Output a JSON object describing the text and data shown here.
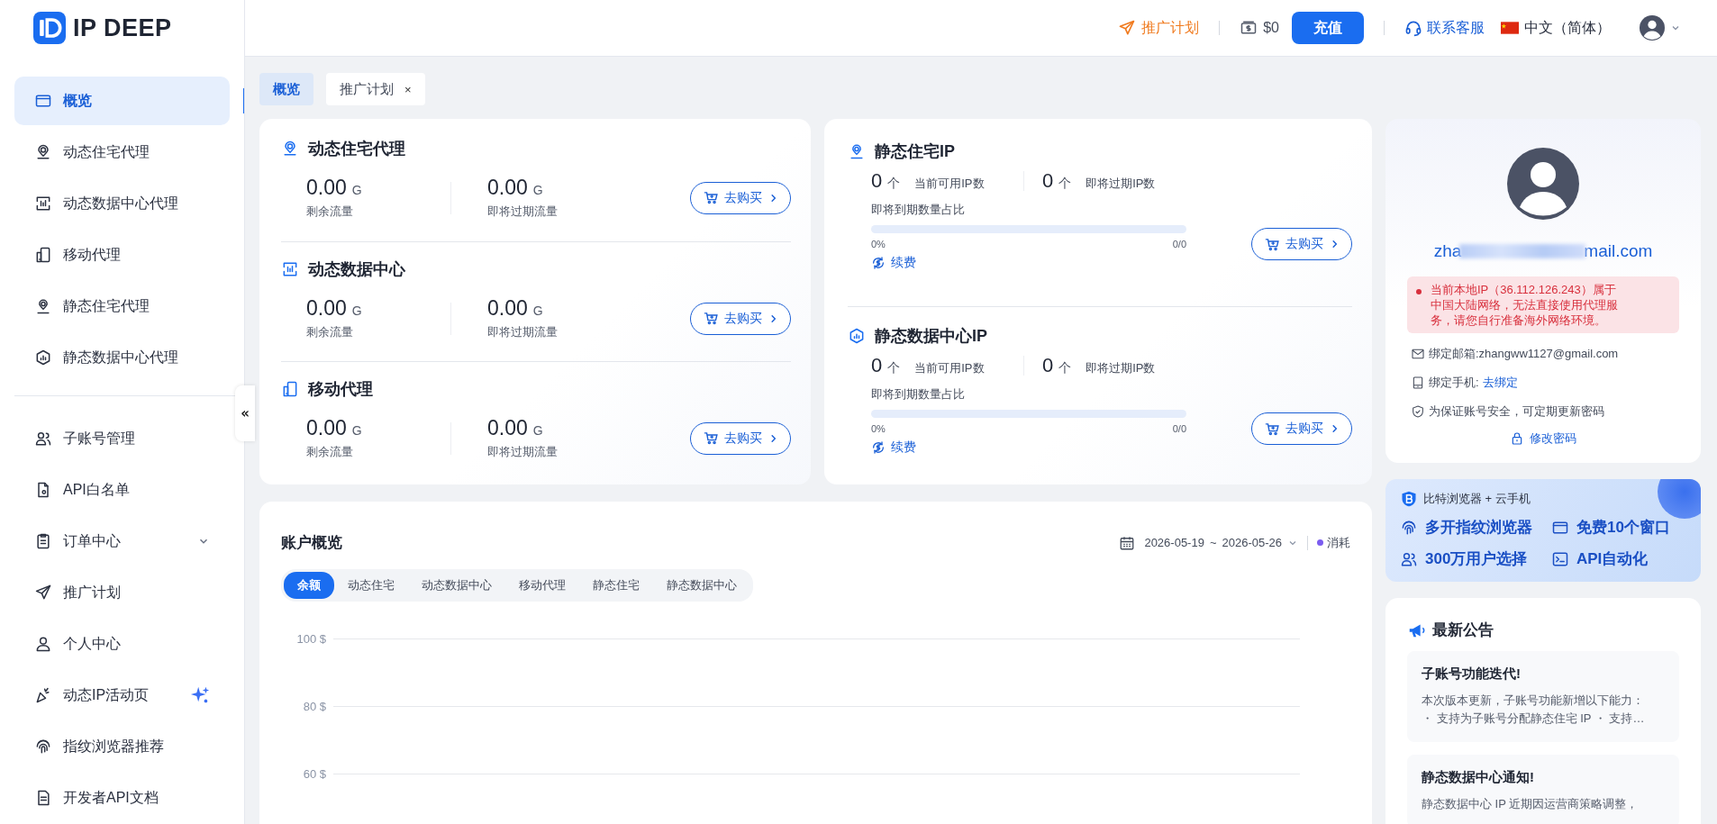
{
  "brand": "IP DEEP",
  "sidebar": {
    "groups": [
      [
        {
          "label": "概览",
          "kind": "link",
          "selected": true
        },
        {
          "label": "动态住宅代理",
          "kind": "link",
          "selected": false
        },
        {
          "label": "动态数据中心代理",
          "kind": "link",
          "selected": false
        },
        {
          "label": "移动代理",
          "kind": "link",
          "selected": false
        },
        {
          "label": "静态住宅代理",
          "kind": "link",
          "selected": false
        },
        {
          "label": "静态数据中心代理",
          "kind": "link",
          "selected": false
        }
      ],
      [
        {
          "label": "子账号管理",
          "kind": "link",
          "selected": false
        },
        {
          "label": "API白名单",
          "kind": "link",
          "selected": false
        },
        {
          "label": "订单中心",
          "kind": "group",
          "expanded": false,
          "selected": false
        },
        {
          "label": "推广计划",
          "kind": "link",
          "selected": false
        },
        {
          "label": "个人中心",
          "kind": "link",
          "selected": false
        },
        {
          "label": "动态IP活动页",
          "kind": "new",
          "selected": false
        },
        {
          "label": "指纹浏览器推荐",
          "kind": "link",
          "selected": false
        },
        {
          "label": "开发者API文档",
          "kind": "link",
          "selected": false
        }
      ]
    ],
    "collapse_button": "«"
  },
  "header": {
    "promo_link": "推广计划",
    "balance": "$0",
    "recharge_button": "充值",
    "support_link": "联系客服",
    "language": "中文（简体）"
  },
  "page_tabs": [
    {
      "label": "概览",
      "selected": true,
      "closable": false
    },
    {
      "label": "推广计划",
      "selected": false,
      "closable": true,
      "close": "×"
    }
  ],
  "dynamic_products": [
    {
      "title": "动态住宅代理",
      "stats": [
        {
          "value": "0.00",
          "unit": "G",
          "label": "剩余流量"
        },
        {
          "value": "0.00",
          "unit": "G",
          "label": "即将过期流量"
        }
      ],
      "buy_button": "去购买"
    },
    {
      "title": "动态数据中心",
      "stats": [
        {
          "value": "0.00",
          "unit": "G",
          "label": "剩余流量"
        },
        {
          "value": "0.00",
          "unit": "G",
          "label": "即将过期流量"
        }
      ],
      "buy_button": "去购买"
    },
    {
      "title": "移动代理",
      "stats": [
        {
          "value": "0.00",
          "unit": "G",
          "label": "剩余流量"
        },
        {
          "value": "0.00",
          "unit": "G",
          "label": "即将过期流量"
        }
      ],
      "buy_button": "去购买"
    }
  ],
  "static_products": [
    {
      "title": "静态住宅IP",
      "stats": [
        {
          "value": "0",
          "unit": "个",
          "label": "当前可用IP数"
        },
        {
          "value": "0",
          "unit": "个",
          "label": "即将过期IP数"
        }
      ],
      "ratio_label": "即将到期数量占比",
      "level": 0,
      "percent": "0%",
      "count": "0/0",
      "renew_link": "续费",
      "buy_button": "去购买"
    },
    {
      "title": "静态数据中心IP",
      "stats": [
        {
          "value": "0",
          "unit": "个",
          "label": "当前可用IP数"
        },
        {
          "value": "0",
          "unit": "个",
          "label": "即将过期IP数"
        }
      ],
      "ratio_label": "即将到期数量占比",
      "level": 0,
      "percent": "0%",
      "count": "0/0",
      "renew_link": "续费",
      "buy_button": "去购买"
    }
  ],
  "account_overview": {
    "title": "账户概览",
    "date_start": "2026-05-19",
    "date_separator": "~",
    "date_end": "2026-05-26",
    "legend": {
      "label": "消耗",
      "color": "#7b5cf0"
    },
    "tabs": [
      {
        "label": "余额",
        "selected": true
      },
      {
        "label": "动态住宅",
        "selected": false
      },
      {
        "label": "动态数据中心",
        "selected": false
      },
      {
        "label": "移动代理",
        "selected": false
      },
      {
        "label": "静态住宅",
        "selected": false
      },
      {
        "label": "静态数据中心",
        "selected": false
      }
    ],
    "axis_labels": [
      "100 $",
      "80 $",
      "60 $"
    ]
  },
  "profile": {
    "email_start": "zha",
    "email_end": "mail.com",
    "warning": "当前本地IP（36.112.126.243）属于中国大陆网络，无法直接使用代理服务，请您自行准备海外网络环境。",
    "bound_email": "绑定邮箱:zhangww1127@gmail.com",
    "bound_phone": "绑定手机:",
    "bind_link": "去绑定",
    "security_note": "为保证账号安全，可定期更新密码",
    "change_password": "修改密码"
  },
  "promo_banner": {
    "brand": "比特浏览器 + 云手机",
    "features": [
      "多开指纹浏览器",
      "免费10个窗口",
      "300万用户选择",
      "API自动化"
    ]
  },
  "notices": {
    "title": "最新公告",
    "items": [
      {
        "title": "子账号功能迭代!",
        "lines": [
          "本次版本更新，子账号功能新增以下能力：",
          "・ 支持为子账号分配静态住宅 IP ・ 支持…"
        ]
      },
      {
        "title": "静态数据中心通知!",
        "lines": [
          "静态数据中心 IP 近期因运营商策略调整，"
        ]
      }
    ]
  }
}
